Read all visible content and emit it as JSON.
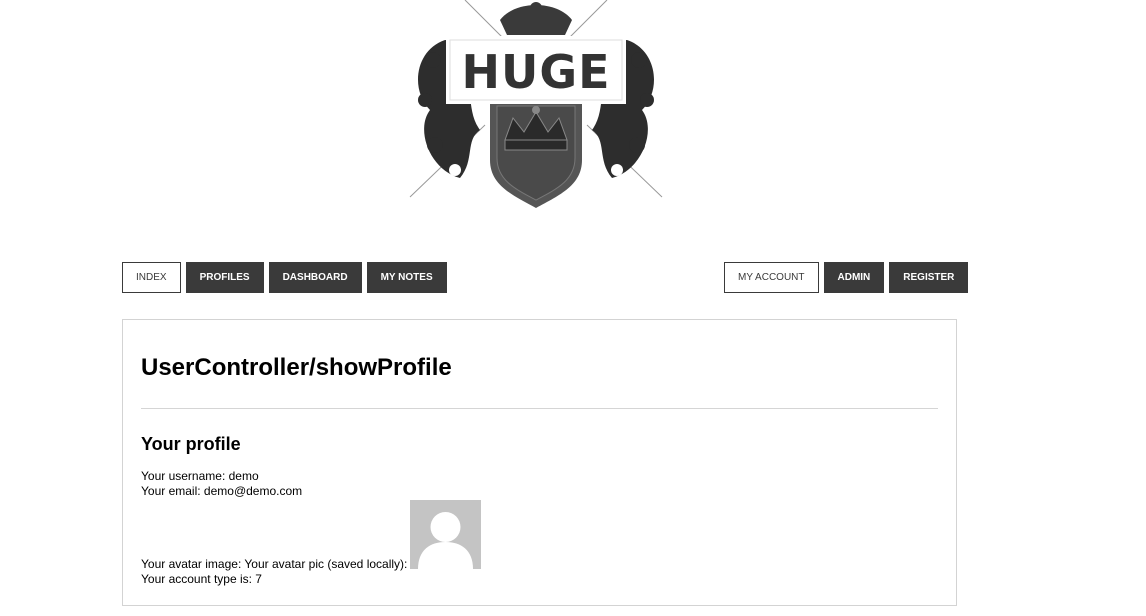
{
  "logo": {
    "text": "HUGE"
  },
  "nav_left": [
    {
      "label": "INDEX",
      "active": true
    },
    {
      "label": "PROFILES",
      "active": false
    },
    {
      "label": "DASHBOARD",
      "active": false
    },
    {
      "label": "MY NOTES",
      "active": false
    }
  ],
  "nav_right": [
    {
      "label": "MY ACCOUNT",
      "active": true
    },
    {
      "label": "ADMIN",
      "active": false
    },
    {
      "label": "REGISTER",
      "active": false
    }
  ],
  "content": {
    "title": "UserController/showProfile",
    "subtitle": "Your profile",
    "username_line": "Your username: demo",
    "email_line": "Your email: demo@demo.com",
    "avatar_line": "Your avatar image: Your avatar pic (saved locally):",
    "account_type_line": "Your account type is: 7"
  },
  "colors": {
    "nav_bg": "#3a3a3a",
    "nav_text": "#ffffff",
    "border": "#d3d3d3",
    "avatar_bg": "#c4c4c4"
  },
  "icons": {
    "logo": "crest-crown-emblem",
    "avatar": "default-user-silhouette"
  }
}
